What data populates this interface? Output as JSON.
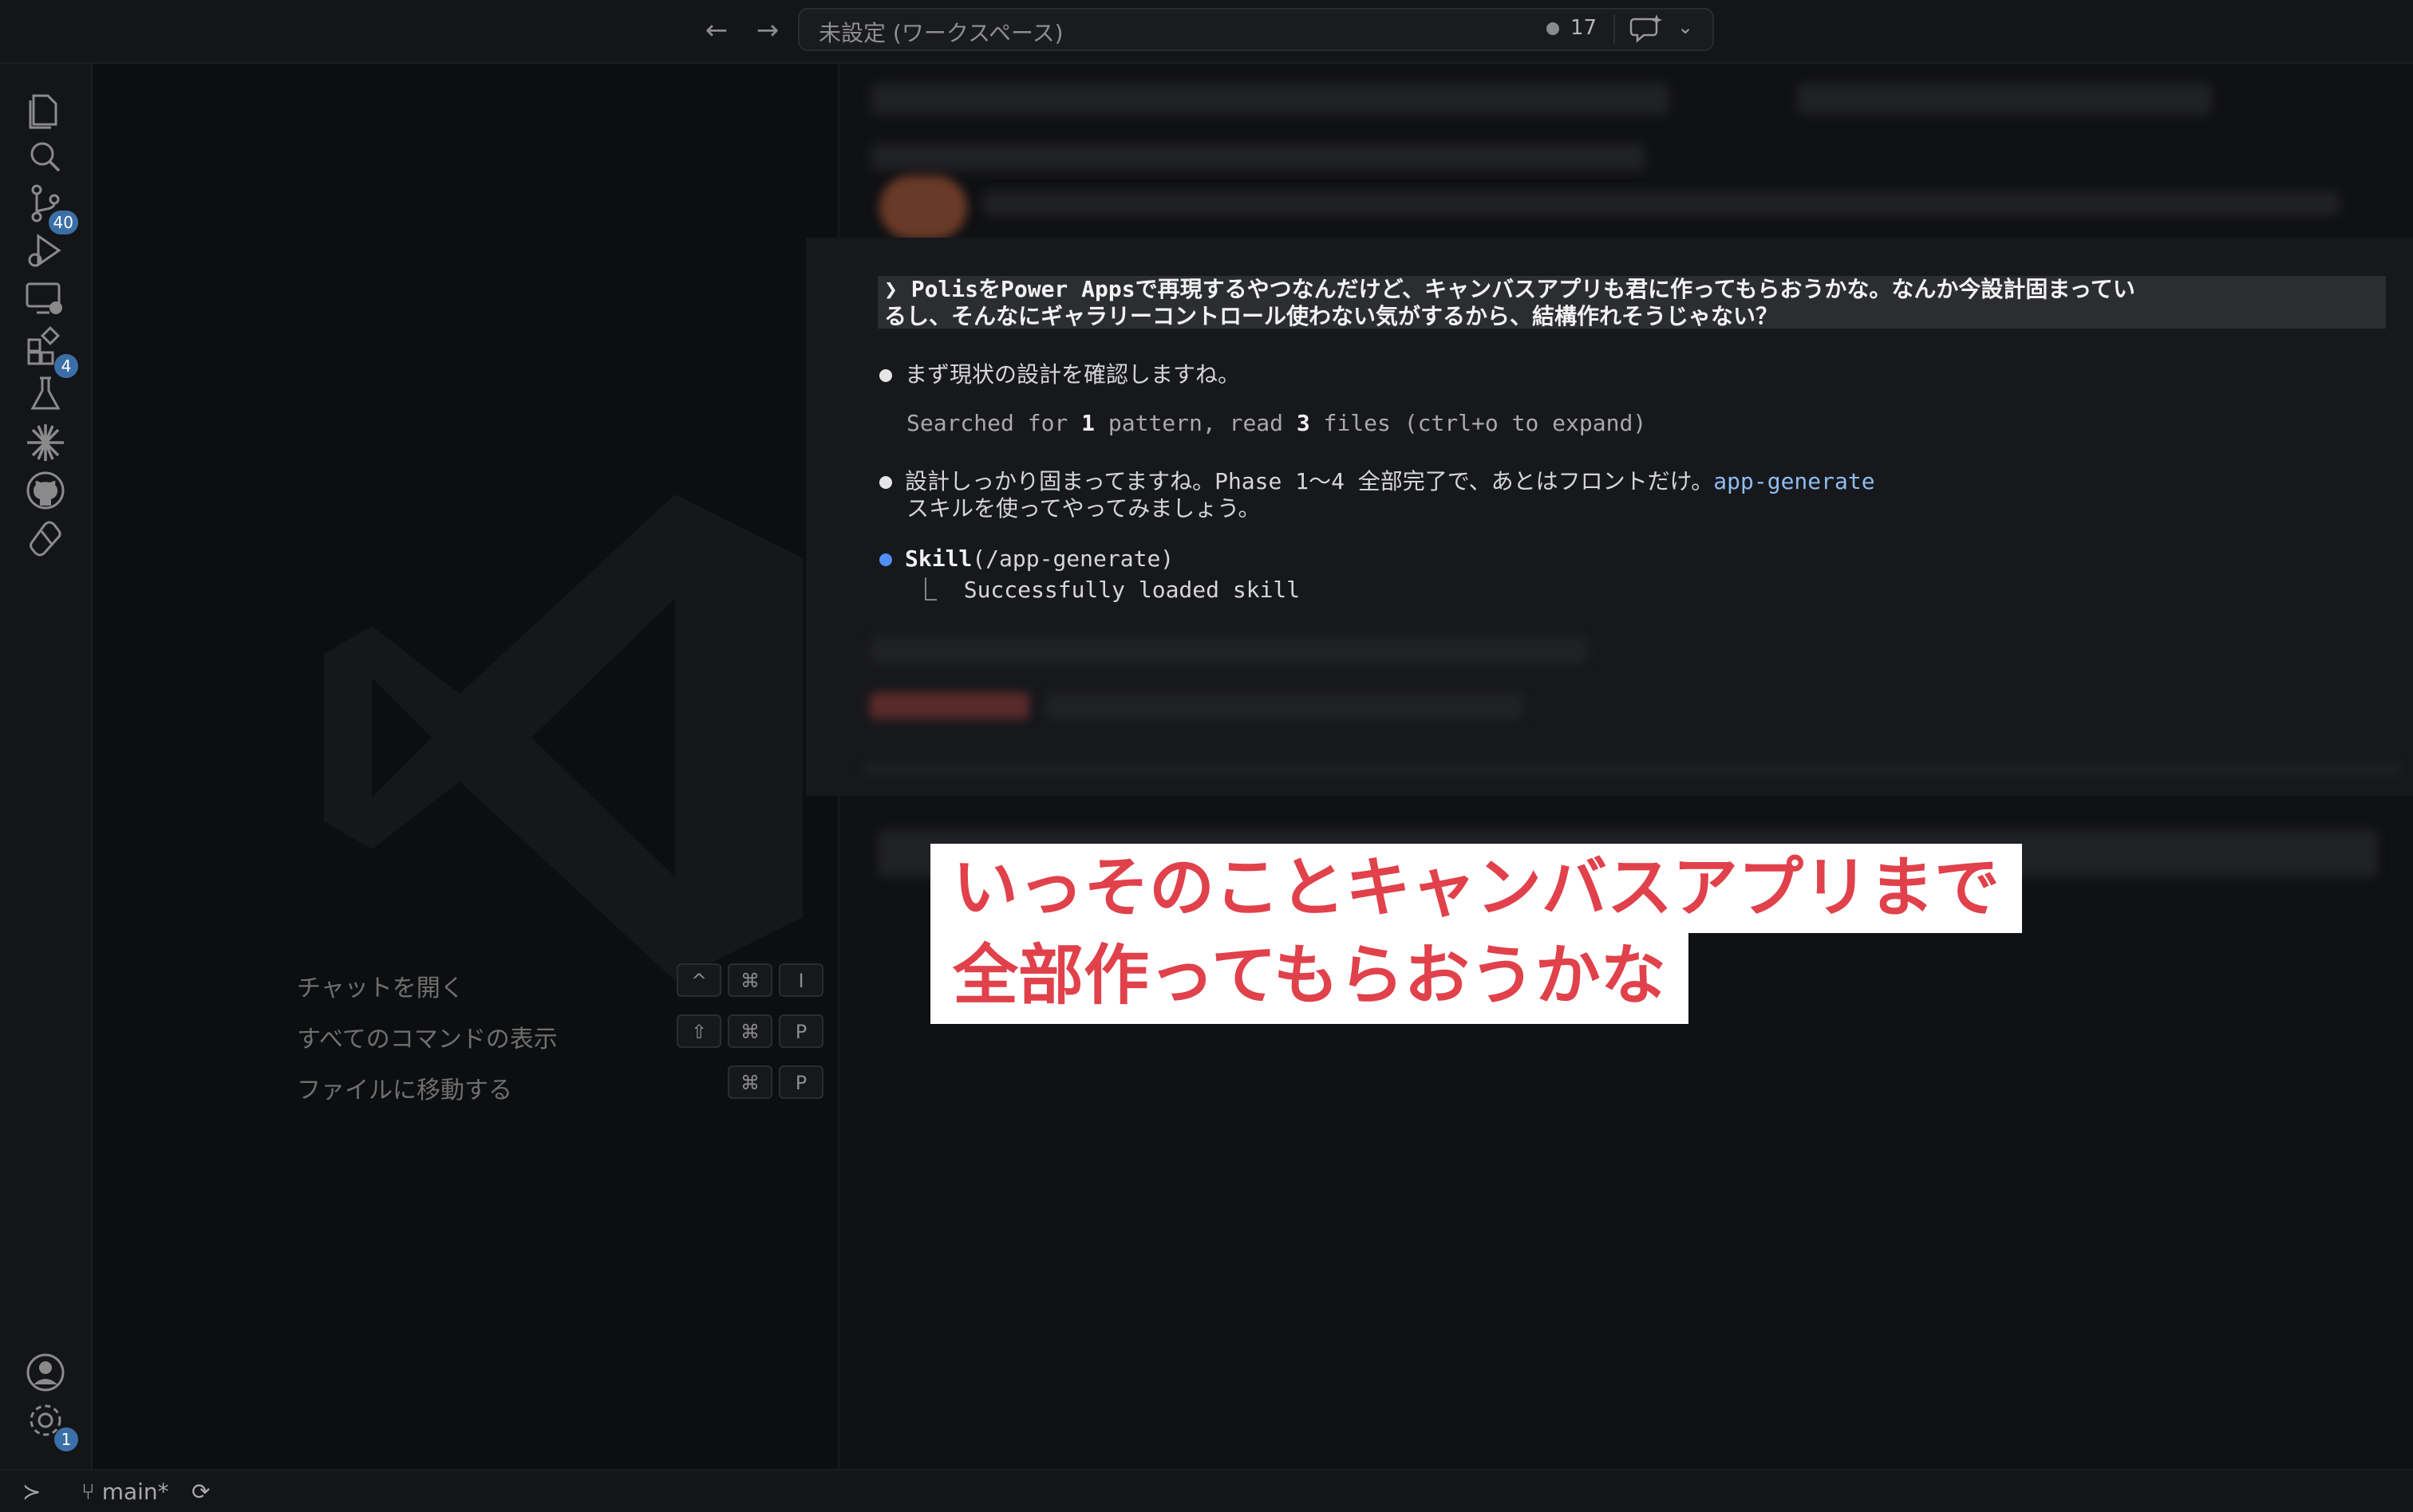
{
  "titlebar": {
    "workspace_label": "未設定 (ワークスペース)",
    "notification_count": "17"
  },
  "activity_bar": {
    "source_control_badge": "40",
    "extensions_badge": "4",
    "settings_badge": "1"
  },
  "welcome": {
    "shortcuts": [
      {
        "label": "チャットを開く",
        "keys": [
          "^",
          "⌘",
          "I"
        ]
      },
      {
        "label": "すべてのコマンドの表示",
        "keys": [
          "⇧",
          "⌘",
          "P"
        ]
      },
      {
        "label": "ファイルに移動する",
        "keys": [
          "⌘",
          "P"
        ]
      }
    ]
  },
  "terminal": {
    "prompt_line1": "❯  PolisをPower Appsで再現するやつなんだけど、キャンバスアプリも君に作ってもらおうかな。なんか今設計固まってい",
    "prompt_line2": "るし、そんなにギャラリーコントロール使わない気がするから、結構作れそうじゃない？",
    "msg1": "まず現状の設計を確認しますね。",
    "searched_pre": "Searched for ",
    "searched_n1": "1",
    "searched_mid": " pattern, read ",
    "searched_n2": "3",
    "searched_post": " files (ctrl+o to expand)",
    "msg2_a": "設計しっかり固まってますね。Phase 1〜4 全部完了で、あとはフロントだけ。",
    "msg2_link": "app-generate",
    "msg2_b": "スキルを使ってやってみましょう。",
    "skill_name": "Skill",
    "skill_arg": "(/app-generate)",
    "skill_result": "⎿  Successfully loaded skill"
  },
  "caption": {
    "line1": "いっそのことキャンバスアプリまで",
    "line2": "全部作ってもらおうかな"
  },
  "statusbar": {
    "branch": "main*"
  }
}
